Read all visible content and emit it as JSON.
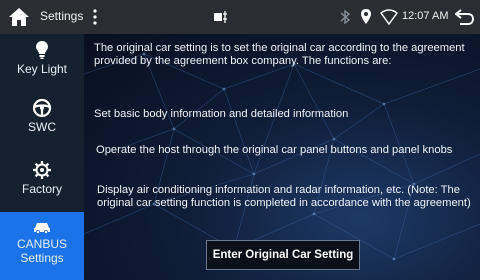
{
  "status_bar": {
    "title": "Settings",
    "time": "12:07 AM",
    "icons": [
      "home-icon",
      "menu-dots-icon",
      "usb-icon",
      "bluetooth-icon",
      "location-icon",
      "wifi-icon",
      "back-icon"
    ]
  },
  "sidebar": {
    "items": [
      {
        "label": "Key Light",
        "icon": "lightbulb-icon",
        "active": false
      },
      {
        "label": "SWC",
        "icon": "steering-wheel-icon",
        "active": false
      },
      {
        "label": "Factory",
        "icon": "gear-icon",
        "active": false
      },
      {
        "label": "CANBUS\nSettings",
        "label_line1": "CANBUS",
        "label_line2": "Settings",
        "icon": "car-icon",
        "active": true
      }
    ],
    "active_color": "#1a73e8"
  },
  "main": {
    "intro": "The original car setting is to set the original car according to the agreement provided by the agreement box company. The functions are:",
    "item1": "Set basic body information and detailed information",
    "item2": "Operate the host through the original car panel buttons and panel knobs",
    "item3": "Display air conditioning information and radar information, etc. (Note: The original car setting function is completed in accordance with the agreement)",
    "button_label": "Enter Original Car Setting"
  }
}
